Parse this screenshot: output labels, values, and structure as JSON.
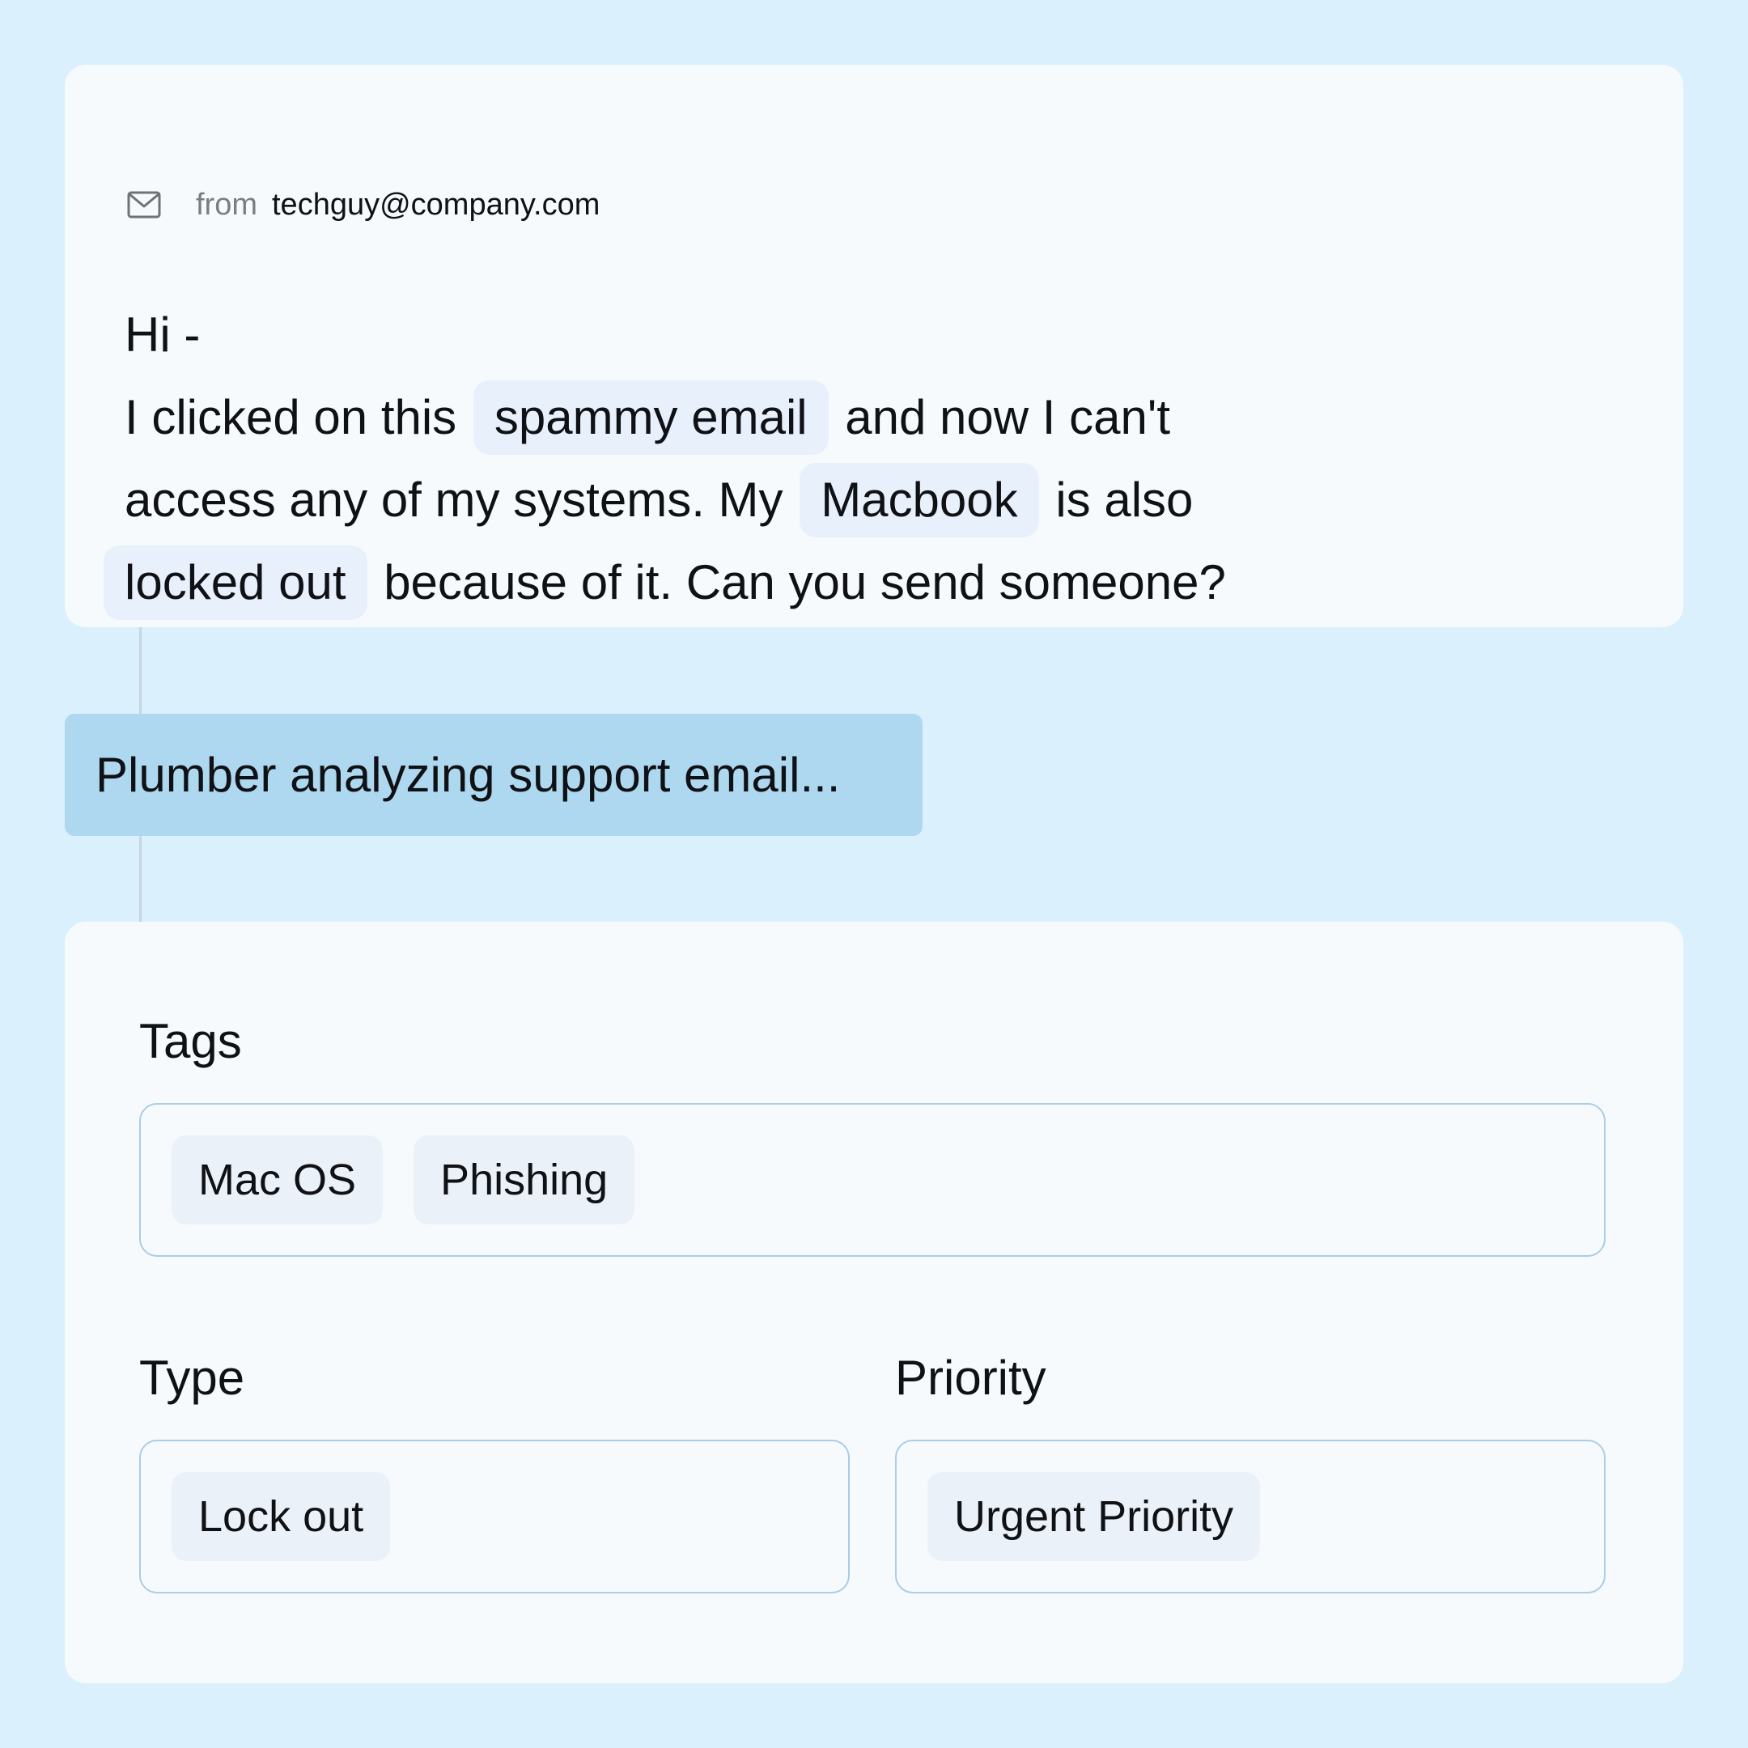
{
  "email": {
    "from_label": "from",
    "from_address": "techguy@company.com",
    "greeting": "Hi -",
    "line1_pre": "I clicked on this",
    "line1_highlight": "spammy email",
    "line1_post": "and now I can't",
    "line2_pre": "access any of my systems. My",
    "line2_highlight": "Macbook",
    "line2_post": "is also",
    "line3_highlight": "locked out",
    "line3_post": "because of it. Can you send someone?"
  },
  "status": {
    "text": "Plumber analyzing support email..."
  },
  "result": {
    "tags_label": "Tags",
    "tags": [
      "Mac OS",
      "Phishing"
    ],
    "type_label": "Type",
    "type_value": "Lock out",
    "priority_label": "Priority",
    "priority_value": "Urgent Priority"
  },
  "icons": {
    "mail": "mail-envelope-icon"
  },
  "colors": {
    "background": "#dbf0fd",
    "card": "#f6fafd",
    "banner": "#add8f0",
    "chip": "#ebf1f9",
    "field_border": "#a9cde6"
  }
}
